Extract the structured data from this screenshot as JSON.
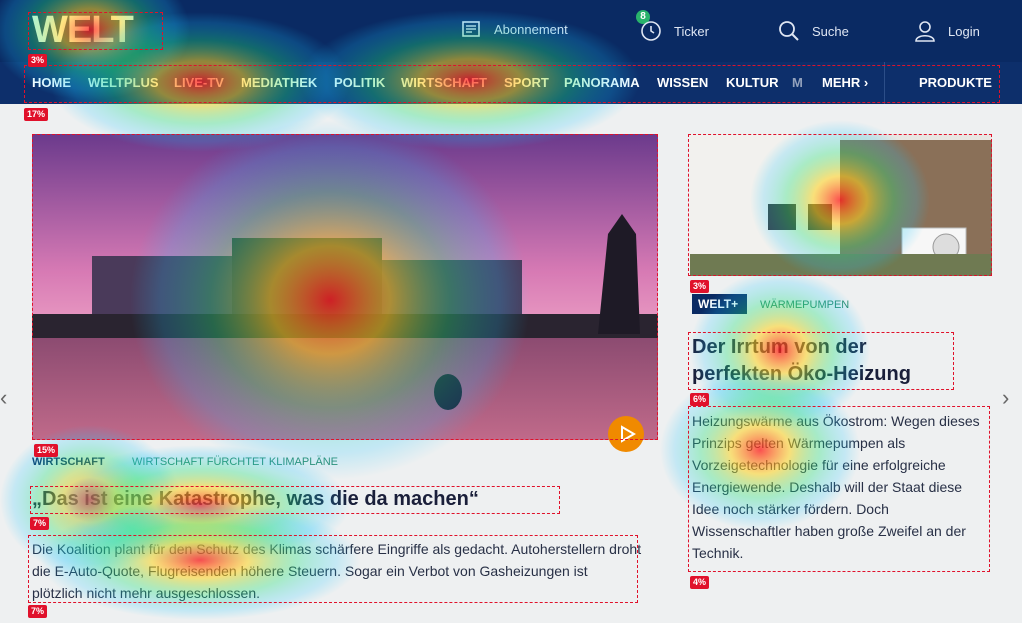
{
  "brand": {
    "logo_text": "WELT"
  },
  "topbar": {
    "items": [
      {
        "label": "Abonnement",
        "icon": "newspaper-icon"
      },
      {
        "label": "Ticker",
        "icon": "clock-icon",
        "badge": "8"
      },
      {
        "label": "Suche",
        "icon": "search-icon"
      },
      {
        "label": "Login",
        "icon": "user-icon"
      }
    ]
  },
  "nav": {
    "items": [
      "HOME",
      "WELTPLUS",
      "LIVE-TV",
      "MEDIATHEK",
      "POLITIK",
      "WIRTSCHAFT",
      "SPORT",
      "PANORAMA",
      "WISSEN",
      "KULTUR",
      "M"
    ],
    "more": "MEHR",
    "products": "PRODUKTE"
  },
  "main_article": {
    "kicker": "WIRTSCHAFT",
    "kicker_sub": "WIRTSCHAFT FÜRCHTET KLIMAPLÄNE",
    "headline": "„Das ist eine Katastrophe, was die da machen“",
    "teaser": "Die Koalition plant für den Schutz des Klimas schärfere Eingriffe als gedacht. Autoherstellern droht die E-Auto-Quote, Flugreisenden höhere Steuern. Sogar ein Verbot von Gasheizungen ist plötzlich nicht mehr ausgeschlossen."
  },
  "side_article": {
    "brand_badge": "WELT+",
    "kicker": "WÄRMEPUMPEN",
    "headline": "Der Irrtum von der perfekten Öko-Heizung",
    "teaser": "Heizungswärme aus Ökostrom: Wegen dieses Prinzips gelten Wärmepumpen als Vorzeigetechnologie für eine erfolgreiche Energiewende. Deshalb will der Staat diese Idee noch stärker fördern. Doch Wissenschaftler haben große Zweifel an der Technik."
  },
  "attention": {
    "logo": "3%",
    "nav": "17%",
    "main_image": "15%",
    "main_headline": "7%",
    "main_teaser": "7%",
    "side_image": "3%",
    "side_headline": "6%",
    "side_teaser": "4%"
  },
  "colors": {
    "header": "#0a2a63",
    "accent": "#f08a00",
    "annotation": "#e0112b",
    "kicker_green": "#2d8a6a"
  }
}
